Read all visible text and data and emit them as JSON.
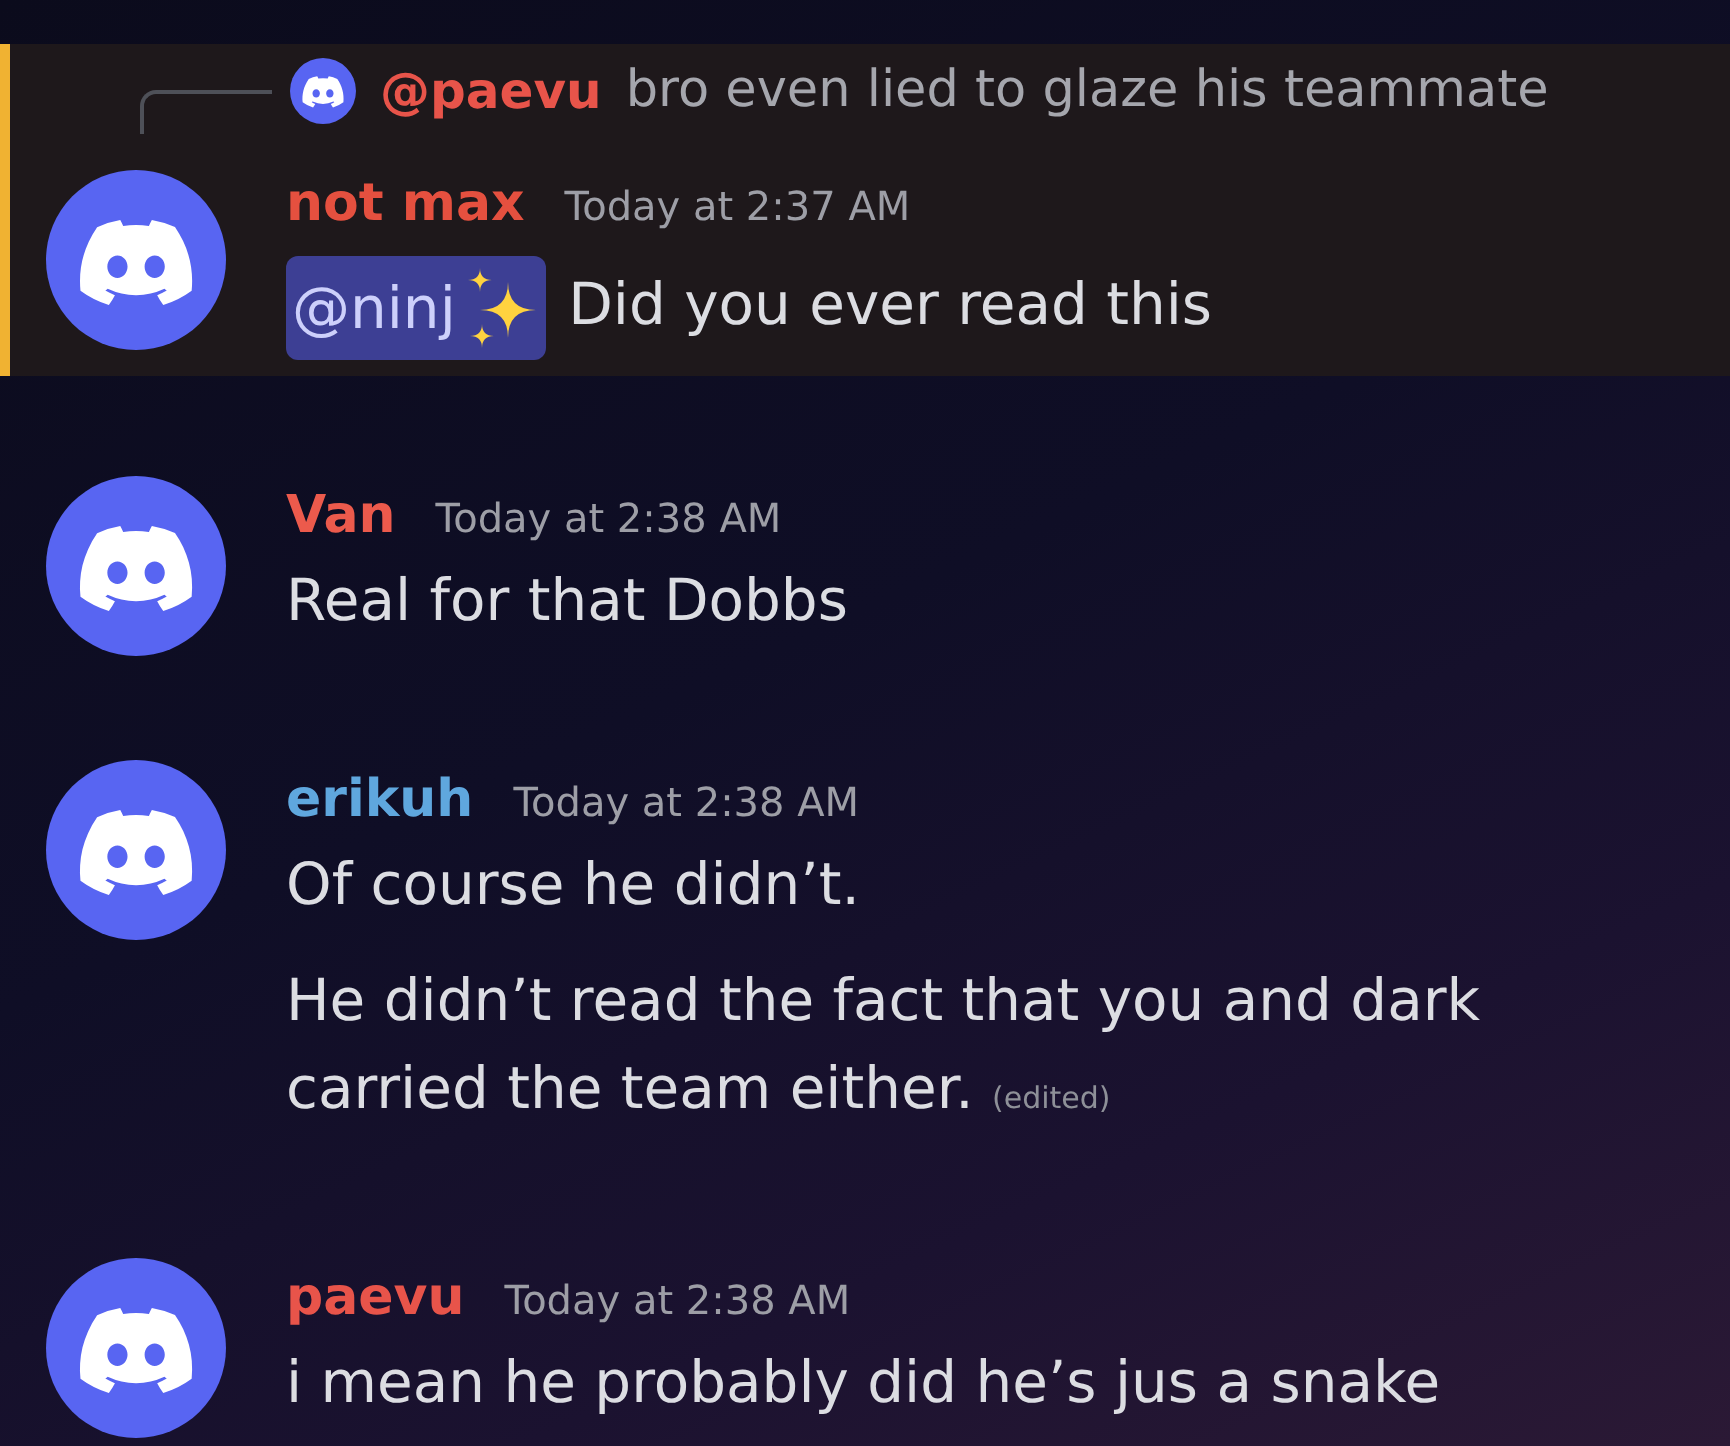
{
  "messages": [
    {
      "highlighted": true,
      "reply": {
        "mention": "@paevu",
        "color": "#e8544a",
        "text": "bro even lied to glaze his teammate"
      },
      "author": "not max",
      "color": "#e5503f",
      "time": "Today at 2:37 AM",
      "paragraphs": [
        {
          "mention": {
            "text": "@ninj",
            "sparkle": true
          },
          "text": "Did you ever read this"
        }
      ]
    },
    {
      "highlighted": false,
      "author": "Van",
      "color": "#ec5a4c",
      "time": "Today at 2:38 AM",
      "paragraphs": [
        {
          "text": "Real for that Dobbs"
        }
      ]
    },
    {
      "highlighted": false,
      "author": "erikuh",
      "color": "#5fa7de",
      "time": "Today at 2:38 AM",
      "paragraphs": [
        {
          "text": "Of course he didn’t."
        },
        {
          "text": "He didn’t read the fact that you and dark carried the team either.",
          "edited_label": "(edited)"
        }
      ]
    },
    {
      "highlighted": false,
      "author": "paevu",
      "color": "#e8544a",
      "time": "Today at 2:38 AM",
      "paragraphs": [
        {
          "text": "i mean he probably did he’s jus a snake"
        }
      ]
    }
  ]
}
